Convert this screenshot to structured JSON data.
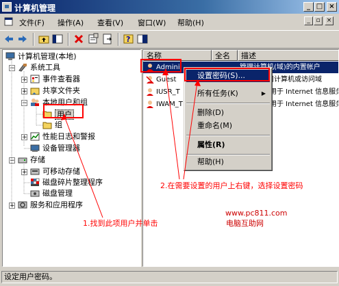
{
  "window": {
    "title": "计算机管理"
  },
  "menu": [
    "文件(F)",
    "操作(A)",
    "查看(V)",
    "窗口(W)",
    "帮助(H)"
  ],
  "tree": {
    "root": "计算机管理(本地)",
    "system_tools": "系统工具",
    "event_viewer": "事件查看器",
    "shared_folders": "共享文件夹",
    "local_users": "本地用户和组",
    "users": "用户",
    "groups": "组",
    "perf_logs": "性能日志和警报",
    "device_manager": "设备管理器",
    "storage": "存储",
    "removable": "可移动存储",
    "defrag": "磁盘碎片整理程序",
    "disk_mgmt": "磁盘管理",
    "services": "服务和应用程序"
  },
  "list": {
    "columns": [
      "名称",
      "全名",
      "描述"
    ],
    "rows": [
      {
        "name": "Admini",
        "desc": "管理计算机(域)的内置帐户"
      },
      {
        "name": "Guest",
        "desc": "供来宾访问计算机或访问域"
      },
      {
        "name": "IUSR_T",
        "desc": "用于 Internet 信息服务"
      },
      {
        "name": "IWAM_T",
        "desc": "用于 Internet 信息服务"
      }
    ]
  },
  "context_menu": {
    "set_password": "设置密码(S)...",
    "all_tasks": "所有任务(K)",
    "delete": "删除(D)",
    "rename": "重命名(M)",
    "properties": "属性(R)",
    "help": "帮助(H)"
  },
  "status": "设定用户密码。",
  "annotations": {
    "step1": "1.找到此项用户并单击",
    "step2": "2.在需要设置的用户上右键，选择设置密码"
  },
  "watermark": {
    "url": "www.pc811.com",
    "name": "电脑互助网"
  },
  "colors": {
    "title_start": "#0a246a",
    "highlight": "#0a246a",
    "annotation": "#ff0000"
  }
}
